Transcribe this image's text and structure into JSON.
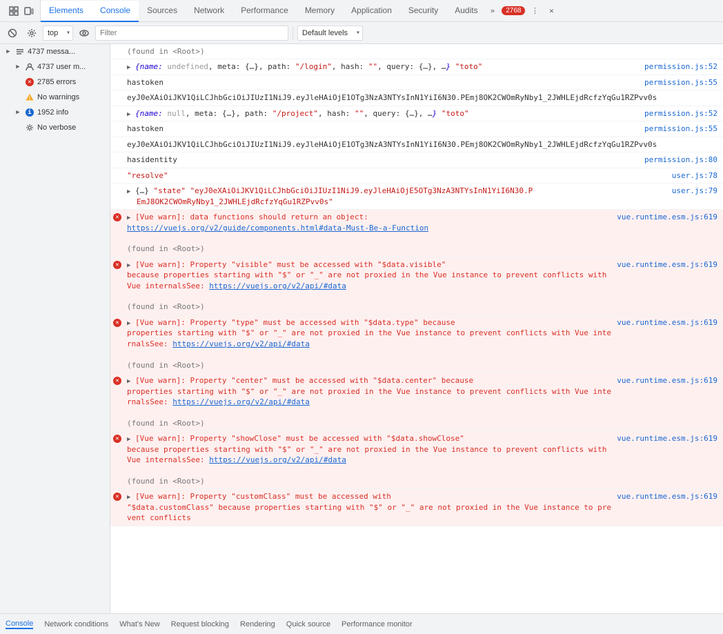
{
  "tabs": [
    {
      "id": "elements",
      "label": "Elements",
      "active": false
    },
    {
      "id": "console",
      "label": "Console",
      "active": true
    },
    {
      "id": "sources",
      "label": "Sources",
      "active": false
    },
    {
      "id": "network",
      "label": "Network",
      "active": false
    },
    {
      "id": "performance",
      "label": "Performance",
      "active": false
    },
    {
      "id": "memory",
      "label": "Memory",
      "active": false
    },
    {
      "id": "application",
      "label": "Application",
      "active": false
    },
    {
      "id": "security",
      "label": "Security",
      "active": false
    },
    {
      "id": "audits",
      "label": "Audits",
      "active": false
    }
  ],
  "error_count": "2768",
  "toolbar": {
    "context_label": "top",
    "filter_placeholder": "Filter",
    "levels_label": "Default levels"
  },
  "sidebar": {
    "items": [
      {
        "id": "messages",
        "label": "4737 messa...",
        "icon": "list",
        "arrow": true,
        "level": 0
      },
      {
        "id": "user-messages",
        "label": "4737 user m...",
        "icon": "person",
        "arrow": true,
        "level": 1
      },
      {
        "id": "errors",
        "label": "2785 errors",
        "icon": "error",
        "arrow": false,
        "level": 1
      },
      {
        "id": "warnings",
        "label": "No warnings",
        "icon": "warning",
        "arrow": false,
        "level": 1
      },
      {
        "id": "info",
        "label": "1952 info",
        "icon": "info",
        "arrow": true,
        "level": 1
      },
      {
        "id": "verbose",
        "label": "No verbose",
        "icon": "gear",
        "arrow": false,
        "level": 1
      }
    ]
  },
  "console_entries": [
    {
      "type": "normal",
      "content": "(found in <Root>)",
      "source": null,
      "indent": false
    },
    {
      "type": "expandable",
      "content": "{name: undefined, meta: {…}, path: \"/login\", hash: \"\", query: {…}, …} \"toto\"",
      "source": "permission.js:52",
      "error": false
    },
    {
      "type": "normal",
      "content": "hastoken",
      "source": "permission.js:55",
      "error": false
    },
    {
      "type": "long-text",
      "content": "eyJ0eXAiOiJKV1QiLCJhbGciOiJIUzI1NiJ9.eyJleHAiOjE1OTg3NzA3NTYsInN1YiI6N30.PEmj8OK2CWOmRyNby1_2JWHLEjdRcfzYqGu1RZPvv0s",
      "source": null
    },
    {
      "type": "expandable",
      "content": "{name: null, meta: {…}, path: \"/project\", hash: \"\", query: {…}, …} \"toto\"",
      "source": "permission.js:52",
      "error": false
    },
    {
      "type": "normal",
      "content": "hastoken",
      "source": "permission.js:55",
      "error": false
    },
    {
      "type": "long-text",
      "content": "eyJ0eXAiOiJKV1QiLCJhbGciOiJIUzI1NiJ9.eyJleHAiOjE1OTg3NzA3NTYsInN1YiI6N30.PEmj8OK2CWOmRyNby1_2JWHLEjdRcfzYqGu1RZPvv0s",
      "source": null
    },
    {
      "type": "normal",
      "content": "hasidentity",
      "source": "permission.js:80"
    },
    {
      "type": "normal",
      "content": "\"resolve\"",
      "source": "user.js:78"
    },
    {
      "type": "expandable",
      "content": "{…} \"state\" \"eyJ0eXAiOiJKV1QiLCJhbGciOiJIUzI1NiJ9.eyJleHAiOjE5OTg3NzA3NTYsInN1YiI6N30.P...",
      "source": "user.js:79",
      "suffix": "EmJ8OK2CWOmRyNby1_2JWHLEjdRcfzYqGu1RZPvv0s\""
    },
    {
      "type": "error-block",
      "icon": "error",
      "main": "[Vue warn]: data functions should return an object:",
      "link": "https://vuejs.org/v2/guide/components.html#data-Must-Be-a-Function",
      "source": "vue.runtime.esm.js:619",
      "found": "(found in <Root>)"
    },
    {
      "type": "error-block",
      "icon": "error",
      "main": "[Vue warn]: Property \"visible\" must be accessed with \"$data.visible\"",
      "body": "because properties starting with \"$\" or \"_\" are not proxied in the Vue instance to prevent conflicts with Vue internalsSee:",
      "link": "https://vuejs.org/v2/api/#data",
      "source": "vue.runtime.esm.js:619",
      "found": "(found in <Root>)"
    },
    {
      "type": "error-block",
      "icon": "error",
      "main": "[Vue warn]: Property \"type\" must be accessed with \"$data.type\" because",
      "body": "properties starting with \"$\" or \"_\" are not proxied in the Vue instance to prevent conflicts with Vue internalsSee:",
      "link": "https://vuejs.org/v2/api/#data",
      "source": "vue.runtime.esm.js:619",
      "found": "(found in <Root>)"
    },
    {
      "type": "error-block",
      "icon": "error",
      "main": "[Vue warn]: Property \"center\" must be accessed with \"$data.center\" because",
      "body": "properties starting with \"$\" or \"_\" are not proxied in the Vue instance to prevent conflicts with Vue internalsSee:",
      "link": "https://vuejs.org/v2/api/#data",
      "source": "vue.runtime.esm.js:619",
      "found": "(found in <Root>)"
    },
    {
      "type": "error-block",
      "icon": "error",
      "main": "[Vue warn]: Property \"showClose\" must be accessed with \"$data.showClose\"",
      "body": "because properties starting with \"$\" or \"_\" are not proxied in the Vue instance to prevent conflicts with Vue internalsSee:",
      "link": "https://vuejs.org/v2/api/#data",
      "source": "vue.runtime.esm.js:619",
      "found": "(found in <Root>)"
    },
    {
      "type": "error-block",
      "icon": "error",
      "main": "[Vue warn]: Property \"customClass\" must be accessed with",
      "body": "\"$data.customClass\" because properties starting with \"$\" or \"_\" are not proxied in the Vue instance to prevent conflicts",
      "source": "vue.runtime.esm.js:619",
      "found": null,
      "partial": true
    }
  ],
  "bottom_tabs": [
    {
      "id": "console",
      "label": "Console",
      "active": true
    },
    {
      "id": "network-conditions",
      "label": "Network conditions",
      "active": false
    },
    {
      "id": "whats-new",
      "label": "What's New",
      "active": false
    },
    {
      "id": "request-blocking",
      "label": "Request blocking",
      "active": false
    },
    {
      "id": "rendering",
      "label": "Rendering",
      "active": false
    },
    {
      "id": "quick-source",
      "label": "Quick source",
      "active": false
    },
    {
      "id": "performance-monitor",
      "label": "Performance monitor",
      "active": false
    }
  ]
}
